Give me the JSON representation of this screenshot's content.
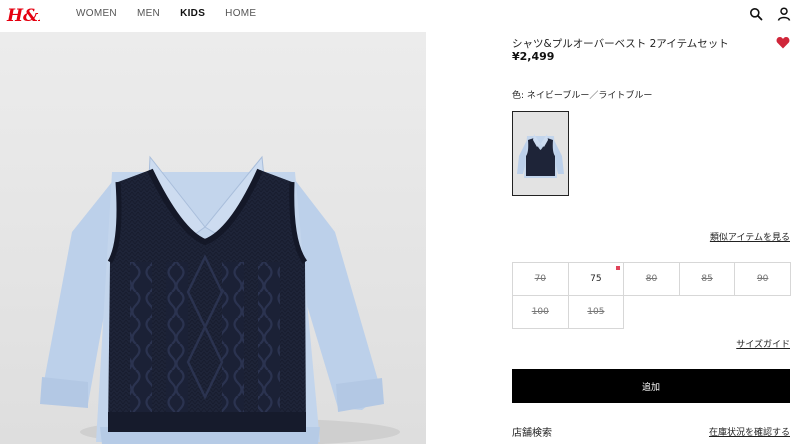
{
  "header": {
    "logo": "H&M",
    "nav": [
      {
        "label": "WOMEN",
        "active": false
      },
      {
        "label": "MEN",
        "active": false
      },
      {
        "label": "KIDS",
        "active": true
      },
      {
        "label": "HOME",
        "active": false
      }
    ],
    "icons": [
      "search-icon",
      "account-icon"
    ]
  },
  "product": {
    "title": "シャツ&プルオーバーベスト 2アイテムセット",
    "price": "¥2,499",
    "color_label": "色: ネイビーブルー／ライトブルー",
    "similar_link": "類似アイテムを見る",
    "sizes": [
      {
        "label": "70",
        "available": false,
        "low_stock": false
      },
      {
        "label": "75",
        "available": true,
        "low_stock": true
      },
      {
        "label": "80",
        "available": false,
        "low_stock": false
      },
      {
        "label": "85",
        "available": false,
        "low_stock": false
      },
      {
        "label": "90",
        "available": false,
        "low_stock": false
      },
      {
        "label": "100",
        "available": false,
        "low_stock": false
      },
      {
        "label": "105",
        "available": false,
        "low_stock": false
      }
    ],
    "size_guide": "サイズガイド",
    "add_button": "追加",
    "store_search": "店舗検索",
    "stock_link": "在庫状況を確認する"
  },
  "colors": {
    "logo_red": "#e50010",
    "favorite_red": "#d0263a",
    "button_black": "#000000",
    "navy": "#1e2438",
    "light_blue": "#bcd0ea"
  }
}
